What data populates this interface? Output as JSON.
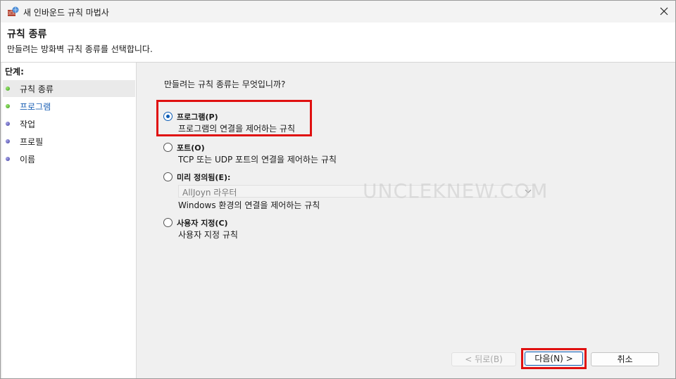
{
  "window": {
    "title": "새 인바운드 규칙 마법사",
    "close_glyph": "✕"
  },
  "header": {
    "title": "규칙 종류",
    "subtitle": "만들려는 방화벽 규칙 종류를 선택합니다."
  },
  "steps": {
    "label": "단계:",
    "items": [
      {
        "label": "규칙 종류",
        "status": "green",
        "active": true
      },
      {
        "label": "프로그램",
        "status": "green",
        "active": false,
        "link": true
      },
      {
        "label": "작업",
        "status": "purple",
        "active": false
      },
      {
        "label": "프로필",
        "status": "purple",
        "active": false
      },
      {
        "label": "이름",
        "status": "purple",
        "active": false
      }
    ]
  },
  "main": {
    "question": "만들려는 규칙 종류는 무엇입니까?",
    "options": [
      {
        "label": "프로그램(P)",
        "desc": "프로그램의 연결을 제어하는 규칙",
        "checked": true
      },
      {
        "label": "포트(O)",
        "desc": "TCP 또는 UDP 포트의 연결을 제어하는 규칙",
        "checked": false
      },
      {
        "label": "미리 정의됨(E):",
        "desc": "Windows 환경의 연결을 제어하는 규칙",
        "checked": false
      },
      {
        "label": "사용자 지정(C)",
        "desc": "사용자 지정 규칙",
        "checked": false
      }
    ],
    "predefined_select": {
      "value": "AllJoyn 라우터",
      "enabled": false
    },
    "watermark": "UNCLEKNEW.COM"
  },
  "buttons": {
    "back": "< 뒤로(B)",
    "next": "다음(N) >",
    "cancel": "취소"
  },
  "colors": {
    "highlight": "#e01010",
    "radio_accent": "#0a5bb5",
    "link": "#1a5fb4"
  }
}
